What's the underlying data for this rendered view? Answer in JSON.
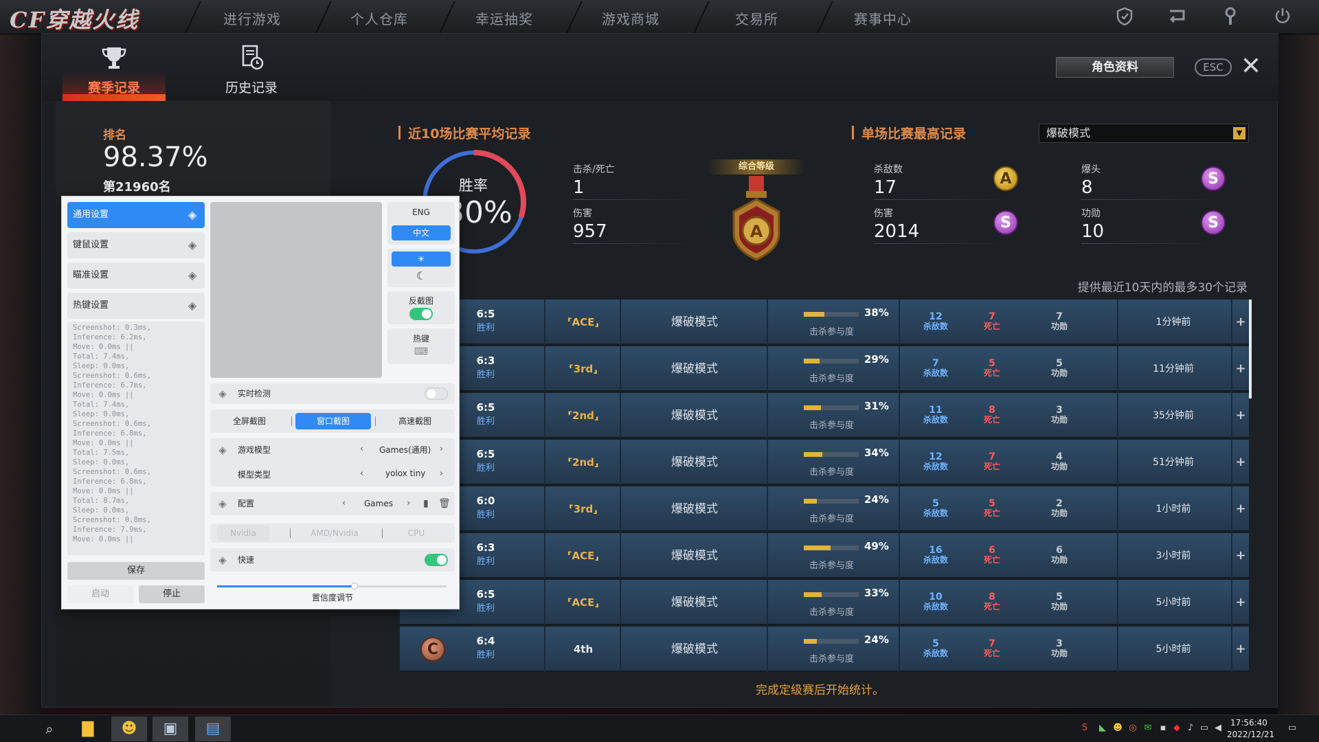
{
  "nav": {
    "logo": "CF穿越火线",
    "items": [
      "进行游戏",
      "个人仓库",
      "幸运抽奖",
      "游戏商城",
      "交易所",
      "赛事中心"
    ]
  },
  "tabs": [
    {
      "label": "赛季记录",
      "icon": "trophy-icon"
    },
    {
      "label": "历史记录",
      "icon": "history-doc-icon"
    }
  ],
  "header": {
    "profile_button": "角色资料",
    "esc_label": "ESC"
  },
  "rank": {
    "label": "排名",
    "percent": "98.37%",
    "position": "第21960名"
  },
  "recent": {
    "title": "近10场比赛平均记录",
    "winrate_label": "胜率",
    "winrate_value": "30%",
    "winrate_fraction": 0.3,
    "kd_label": "击杀/死亡",
    "kd_value": "1",
    "damage_label": "伤害",
    "damage_value": "957"
  },
  "medal": {
    "label": "综合等级",
    "grade": "A"
  },
  "best": {
    "title": "单场比赛最高记录",
    "kills_label": "杀敌数",
    "kills_value": "17",
    "kills_grade": "A",
    "damage_label": "伤害",
    "damage_value": "2014",
    "damage_grade": "S",
    "headshot_label": "爆头",
    "headshot_value": "8",
    "headshot_grade": "S",
    "merit_label": "功勋",
    "merit_value": "10",
    "merit_grade": "S"
  },
  "mode_select": {
    "value": "爆破模式"
  },
  "records_note": "提供最近10天内的最多30个记录",
  "matches": [
    {
      "score": "6:5",
      "result": "胜利",
      "rank": "ACE",
      "mode": "爆破模式",
      "participation": 38,
      "part_label": "击杀参与度",
      "kills": "12",
      "kills_lbl": "杀敌数",
      "deaths": "7",
      "deaths_lbl": "死亡",
      "merit": "7",
      "merit_lbl": "功勋",
      "time": "1分钟前"
    },
    {
      "score": "6:3",
      "result": "胜利",
      "rank": "3rd",
      "mode": "爆破模式",
      "participation": 29,
      "part_label": "击杀参与度",
      "kills": "7",
      "kills_lbl": "杀敌数",
      "deaths": "5",
      "deaths_lbl": "死亡",
      "merit": "5",
      "merit_lbl": "功勋",
      "time": "11分钟前"
    },
    {
      "score": "6:5",
      "result": "胜利",
      "rank": "2nd",
      "mode": "爆破模式",
      "participation": 31,
      "part_label": "击杀参与度",
      "kills": "11",
      "kills_lbl": "杀敌数",
      "deaths": "8",
      "deaths_lbl": "死亡",
      "merit": "3",
      "merit_lbl": "功勋",
      "time": "35分钟前"
    },
    {
      "score": "6:5",
      "result": "胜利",
      "rank": "2nd",
      "mode": "爆破模式",
      "participation": 34,
      "part_label": "击杀参与度",
      "kills": "12",
      "kills_lbl": "杀敌数",
      "deaths": "7",
      "deaths_lbl": "死亡",
      "merit": "4",
      "merit_lbl": "功勋",
      "time": "51分钟前"
    },
    {
      "score": "6:0",
      "result": "胜利",
      "rank": "3rd",
      "mode": "爆破模式",
      "participation": 24,
      "part_label": "击杀参与度",
      "kills": "5",
      "kills_lbl": "杀敌数",
      "deaths": "5",
      "deaths_lbl": "死亡",
      "merit": "2",
      "merit_lbl": "功勋",
      "time": "1小时前"
    },
    {
      "score": "6:3",
      "result": "胜利",
      "rank": "ACE",
      "mode": "爆破模式",
      "participation": 49,
      "part_label": "击杀参与度",
      "kills": "16",
      "kills_lbl": "杀敌数",
      "deaths": "6",
      "deaths_lbl": "死亡",
      "merit": "6",
      "merit_lbl": "功勋",
      "time": "3小时前"
    },
    {
      "score": "6:5",
      "result": "胜利",
      "rank": "ACE",
      "mode": "爆破模式",
      "participation": 33,
      "part_label": "击杀参与度",
      "kills": "10",
      "kills_lbl": "杀敌数",
      "deaths": "8",
      "deaths_lbl": "死亡",
      "merit": "5",
      "merit_lbl": "功勋",
      "time": "5小时前"
    },
    {
      "score": "6:4",
      "result": "胜利",
      "rank": "4th",
      "mode": "爆破模式",
      "participation": 24,
      "part_label": "击杀参与度",
      "kills": "5",
      "kills_lbl": "杀敌数",
      "deaths": "7",
      "deaths_lbl": "死亡",
      "merit": "3",
      "merit_lbl": "功勋",
      "time": "5小时前",
      "grade": "C"
    }
  ],
  "footer_note": "完成定级赛后开始统计。",
  "app": {
    "menu": [
      "通用设置",
      "键鼠设置",
      "瞄准设置",
      "热键设置"
    ],
    "log": "Screenshot: 0.3ms,\nInference: 6.2ms,\nMove: 0.0ms ||\nTotal: 7.4ms,\nSleep: 0.0ms,\nScreenshot: 0.6ms,\nInference: 6.7ms,\nMove: 0.0ms ||\nTotal: 7.4ms,\nSleep: 0.0ms,\nScreenshot: 0.6ms,\nInference: 6.8ms,\nMove: 0.0ms ||\nTotal: 7.5ms,\nSleep: 0.0ms,\nScreenshot: 0.6ms,\nInference: 6.8ms,\nMove: 0.0ms ||\nTotal: 8.7ms,\nSleep: 0.0ms,\nScreenshot: 0.8ms,\nInference: 7.9ms,\nMove: 0.0ms ||",
    "save": "保存",
    "start": "启动",
    "stop": "停止",
    "lang_eng": "ENG",
    "lang_cn": "中文",
    "invert_label": "反截图",
    "hotkey_label": "热键",
    "realtime_label": "实时检测",
    "capture_modes": [
      "全屏截图",
      "窗口截图",
      "高速截图"
    ],
    "game_model_label": "游戏模型",
    "game_model_value": "Games(通用)",
    "model_type_label": "模型类型",
    "model_type_value": "yolox tiny",
    "config_label": "配置",
    "config_value": "Games",
    "devices": [
      "Nvidia",
      "AMD/Nvidia",
      "CPU"
    ],
    "fast_label": "快速",
    "confidence_label": "置信度调节",
    "confidence_value": 0.6
  },
  "taskbar": {
    "time": "17:56:40",
    "date": "2022/12/21"
  }
}
